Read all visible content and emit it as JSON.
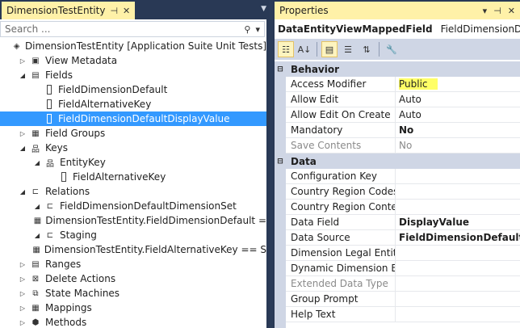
{
  "left_pane": {
    "tab_title": "DimensionTestEntity",
    "search_placeholder": "Search ...",
    "tree": [
      {
        "label": "DimensionTestEntity [Application Suite Unit Tests]",
        "depth": 0,
        "expander": "",
        "icon": "entity-icon",
        "glyph": "◈"
      },
      {
        "label": "View Metadata",
        "depth": 1,
        "expander": "▷",
        "icon": "view-metadata-icon",
        "glyph": "▣"
      },
      {
        "label": "Fields",
        "depth": 1,
        "expander": "◢",
        "icon": "fields-icon",
        "glyph": "▤"
      },
      {
        "label": "FieldDimensionDefault",
        "depth": 2,
        "expander": "",
        "icon": "field-icon",
        "glyph": ""
      },
      {
        "label": "FieldAlternativeKey",
        "depth": 2,
        "expander": "",
        "icon": "field-icon",
        "glyph": ""
      },
      {
        "label": "FieldDimensionDefaultDisplayValue",
        "depth": 2,
        "expander": "",
        "icon": "field-icon",
        "glyph": "",
        "selected": true
      },
      {
        "label": "Field Groups",
        "depth": 1,
        "expander": "▷",
        "icon": "field-groups-icon",
        "glyph": "▦"
      },
      {
        "label": "Keys",
        "depth": 1,
        "expander": "◢",
        "icon": "keys-icon",
        "glyph": "品"
      },
      {
        "label": "EntityKey",
        "depth": 2,
        "expander": "◢",
        "icon": "key-icon",
        "glyph": "品"
      },
      {
        "label": "FieldAlternativeKey",
        "depth": 3,
        "expander": "",
        "icon": "field-icon",
        "glyph": ""
      },
      {
        "label": "Relations",
        "depth": 1,
        "expander": "◢",
        "icon": "relations-icon",
        "glyph": "⊏"
      },
      {
        "label": "FieldDimensionDefaultDimensionSet",
        "depth": 2,
        "expander": "◢",
        "icon": "relation-icon",
        "glyph": "⊏"
      },
      {
        "label": "DimensionTestEntity.FieldDimensionDefault =",
        "depth": 3,
        "expander": "",
        "icon": "relation-constraint-icon",
        "glyph": "▦"
      },
      {
        "label": "Staging",
        "depth": 2,
        "expander": "◢",
        "icon": "relation-icon",
        "glyph": "⊏"
      },
      {
        "label": "DimensionTestEntity.FieldAlternativeKey == S",
        "depth": 3,
        "expander": "",
        "icon": "relation-constraint-icon",
        "glyph": "▦"
      },
      {
        "label": "Ranges",
        "depth": 1,
        "expander": "▷",
        "icon": "ranges-icon",
        "glyph": "▤"
      },
      {
        "label": "Delete Actions",
        "depth": 1,
        "expander": "▷",
        "icon": "delete-actions-icon",
        "glyph": "⊠"
      },
      {
        "label": "State Machines",
        "depth": 1,
        "expander": "▷",
        "icon": "state-machines-icon",
        "glyph": "⧉"
      },
      {
        "label": "Mappings",
        "depth": 1,
        "expander": "▷",
        "icon": "mappings-icon",
        "glyph": "▦"
      },
      {
        "label": "Methods",
        "depth": 1,
        "expander": "▷",
        "icon": "methods-icon",
        "glyph": "⬢"
      }
    ]
  },
  "properties": {
    "title": "Properties",
    "object_type": "DataEntityViewMappedField",
    "object_name": "FieldDimensionDefaultD",
    "categories": [
      {
        "name": "Behavior",
        "rows": [
          {
            "name": "Access Modifier",
            "value": "Public",
            "highlight": true
          },
          {
            "name": "Allow Edit",
            "value": "Auto"
          },
          {
            "name": "Allow Edit On Create",
            "value": "Auto"
          },
          {
            "name": "Mandatory",
            "value": "No",
            "bold": true
          },
          {
            "name": "Save Contents",
            "value": "No",
            "disabled": true
          }
        ]
      },
      {
        "name": "Data",
        "rows": [
          {
            "name": "Configuration Key",
            "value": ""
          },
          {
            "name": "Country Region Codes",
            "value": ""
          },
          {
            "name": "Country Region Context",
            "value": ""
          },
          {
            "name": "Data Field",
            "value": "DisplayValue",
            "bold": true
          },
          {
            "name": "Data Source",
            "value": "FieldDimensionDefaultDAVS",
            "bold": true
          },
          {
            "name": "Dimension Legal Entity C",
            "value": ""
          },
          {
            "name": "Dynamic Dimension Enu",
            "value": ""
          },
          {
            "name": "Extended Data Type",
            "value": "",
            "disabled": true
          },
          {
            "name": "Group Prompt",
            "value": ""
          },
          {
            "name": "Help Text",
            "value": ""
          }
        ]
      }
    ]
  }
}
